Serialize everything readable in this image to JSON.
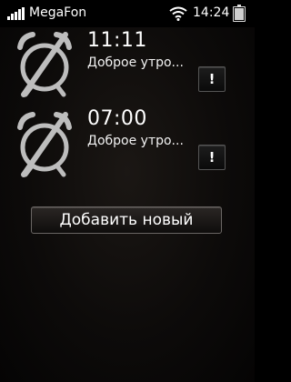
{
  "status_bar": {
    "carrier": "MegaFon",
    "time": "14:24",
    "icons": [
      "signal-icon",
      "wifi-icon",
      "battery-icon"
    ]
  },
  "alarms": [
    {
      "time": "11:11",
      "label": "Доброе утро...",
      "toggle_label": "!",
      "enabled": false
    },
    {
      "time": "07:00",
      "label": "Доброе утро...",
      "toggle_label": "!",
      "enabled": false
    }
  ],
  "add_button": {
    "label": "Добавить новый"
  },
  "colors": {
    "background": "#0d0b0a",
    "text": "#ffffff",
    "icon": "#bdbdbd"
  }
}
